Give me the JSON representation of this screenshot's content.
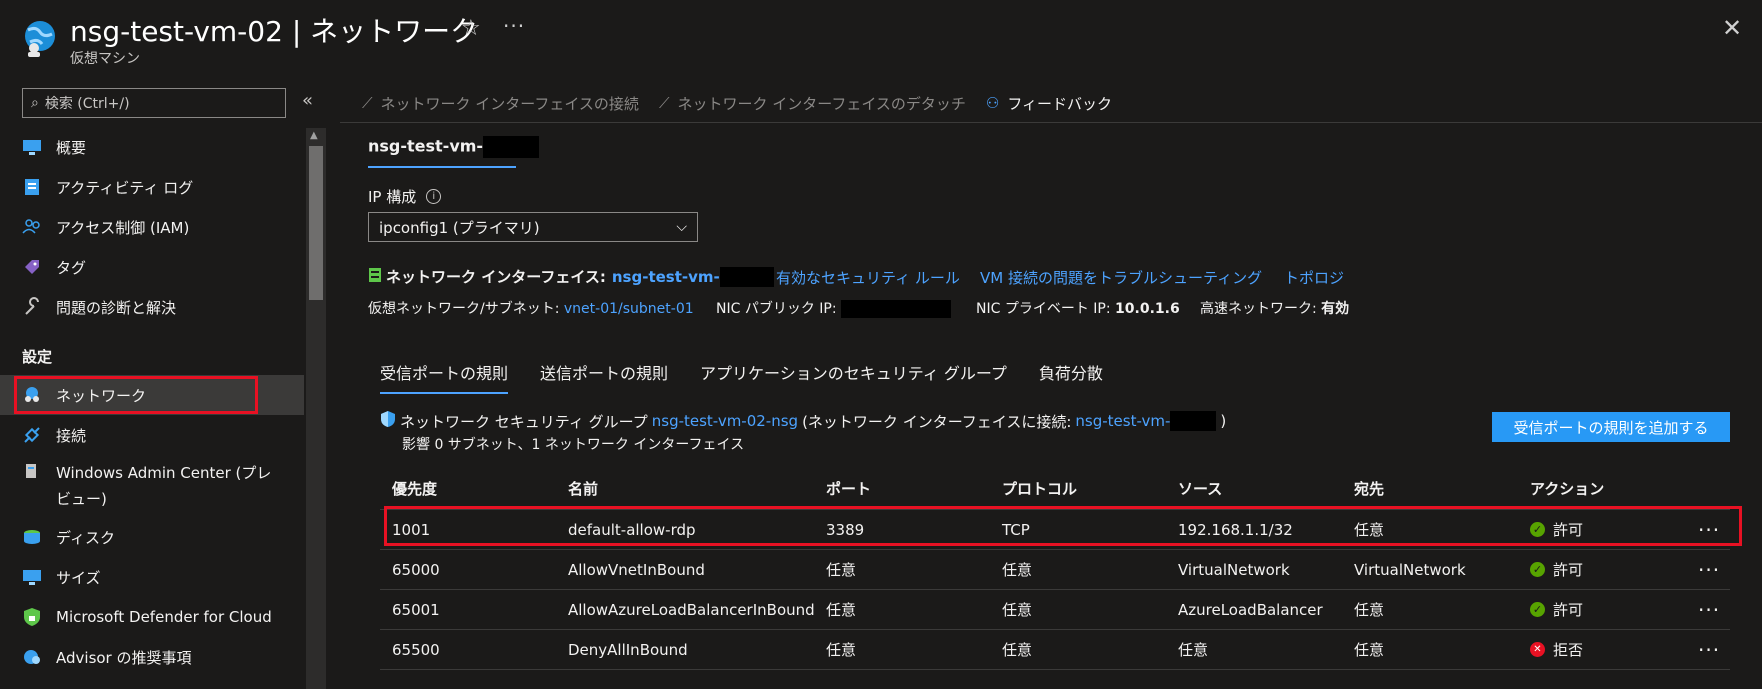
{
  "header": {
    "title": "nsg-test-vm-02 | ネットワーク",
    "subtitle": "仮想マシン"
  },
  "sidebar": {
    "search_placeholder": "検索 (Ctrl+/)",
    "items": [
      {
        "label": "概要",
        "icon": "monitor-icon"
      },
      {
        "label": "アクティビティ ログ",
        "icon": "activity-log-icon"
      },
      {
        "label": "アクセス制御 (IAM)",
        "icon": "people-icon"
      },
      {
        "label": "タグ",
        "icon": "tag-icon"
      },
      {
        "label": "問題の診断と解決",
        "icon": "wrench-icon"
      }
    ],
    "section_settings": "設定",
    "settings_items": [
      {
        "label": "ネットワーク",
        "icon": "network-icon"
      },
      {
        "label": "接続",
        "icon": "connect-icon"
      },
      {
        "label": "Windows Admin Center (プレビュー)",
        "icon": "admin-center-icon"
      },
      {
        "label": "ディスク",
        "icon": "disk-icon"
      },
      {
        "label": "サイズ",
        "icon": "size-icon"
      },
      {
        "label": "Microsoft Defender for Cloud",
        "icon": "defender-icon"
      },
      {
        "label": "Advisor の推奨事項",
        "icon": "advisor-icon"
      }
    ]
  },
  "toolbar": {
    "attach": "ネットワーク インターフェイスの接続",
    "detach": "ネットワーク インターフェイスのデタッチ",
    "feedback": "フィードバック"
  },
  "nic_tab": "nsg-test-vm-",
  "ipconfig": {
    "label": "IP 構成",
    "selected": "ipconfig1 (プライマリ)"
  },
  "nic": {
    "label": "ネットワーク インターフェイス:",
    "name": "nsg-test-vm-",
    "link_effective_rules": "有効なセキュリティ ルール",
    "link_troubleshoot": "VM 接続の問題をトラブルシューティング",
    "link_topology": "トポロジ",
    "vnet_label": "仮想ネットワーク/サブネット:",
    "vnet_value": "vnet-01/subnet-01",
    "public_ip_label": "NIC パブリック IP:",
    "private_ip_label": "NIC プライベート IP:",
    "private_ip_value": "10.0.1.6",
    "accel_label": "高速ネットワーク:",
    "accel_value": "有効"
  },
  "rule_tabs": [
    "受信ポートの規則",
    "送信ポートの規則",
    "アプリケーションのセキュリティ グループ",
    "負荷分散"
  ],
  "nsg": {
    "prefix": "ネットワーク セキュリティ グループ",
    "name": "nsg-test-vm-02-nsg",
    "attached_prefix": "(ネットワーク インターフェイスに接続:",
    "attached_name": "nsg-test-vm-",
    "attached_suffix": ")",
    "impact": "影響 0 サブネット、1 ネットワーク インターフェイス",
    "add_rule_button": "受信ポートの規則を追加する"
  },
  "table": {
    "headers": [
      "優先度",
      "名前",
      "ポート",
      "プロトコル",
      "ソース",
      "宛先",
      "アクション"
    ],
    "rows": [
      [
        "1001",
        "default-allow-rdp",
        "3389",
        "TCP",
        "192.168.1.1/32",
        "任意",
        "許可"
      ],
      [
        "65000",
        "AllowVnetInBound",
        "任意",
        "任意",
        "VirtualNetwork",
        "VirtualNetwork",
        "許可"
      ],
      [
        "65001",
        "AllowAzureLoadBalancerInBound",
        "任意",
        "任意",
        "AzureLoadBalancer",
        "任意",
        "許可"
      ],
      [
        "65500",
        "DenyAllInBound",
        "任意",
        "任意",
        "任意",
        "任意",
        "拒否"
      ]
    ],
    "row_status": [
      "allow",
      "allow",
      "allow",
      "deny"
    ]
  },
  "colors": {
    "accent": "#4da3ff",
    "highlight": "#e81123",
    "allow": "#57a300",
    "deny": "#e81123",
    "button": "#2899f5"
  }
}
